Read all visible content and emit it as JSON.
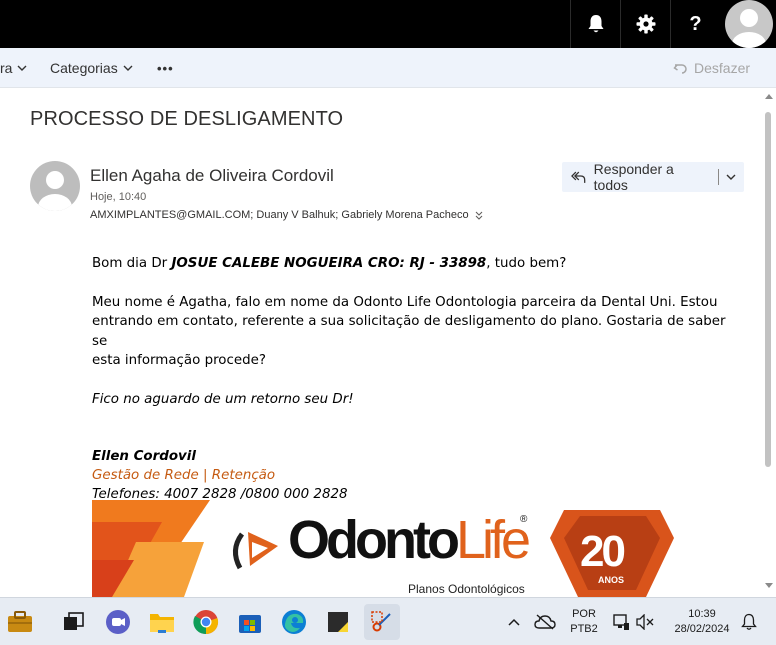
{
  "topbar": {
    "icons": [
      "bell-icon",
      "gear-icon",
      "help-icon",
      "user-avatar"
    ],
    "help_glyph": "?"
  },
  "commandbar": {
    "partial_item": "ra",
    "categories_label": "Categorias",
    "more_label": "•••",
    "undo_label": "Desfazer"
  },
  "message": {
    "subject": "PROCESSO DE DESLIGAMENTO",
    "sender_name": "Ellen Agaha de Oliveira Cordovil",
    "sent_time": "Hoje, 10:40",
    "recipients": "AMXIMPLANTES@GMAIL.COM; Duany V Balhuk; Gabriely Morena Pacheco",
    "reply_all_label": "Responder a todos",
    "body": {
      "greeting_prefix": "Bom dia Dr ",
      "greeting_name": "JOSUE CALEBE NOGUEIRA CRO: RJ - 33898",
      "greeting_suffix": ", tudo bem?",
      "para1_line1": "Meu nome é Agatha, falo em nome da Odonto Life Odontologia parceira da Dental Uni. Estou",
      "para1_line2": "entrando em contato, referente a sua solicitação de desligamento do plano. Gostaria de saber se",
      "para1_line3": "esta informação procede?",
      "para2": "Fico no aguardo de um retorno seu Dr!",
      "sig_name": "Ellen Cordovil",
      "sig_role": "Gestão de Rede | Retenção",
      "sig_phones": "Telefones: 4007 2828 /0800 000 2828"
    },
    "banner": {
      "brand_part1": "Odonto",
      "brand_part2": "Life",
      "registered": "®",
      "tagline": "Planos Odontológicos",
      "badge_number": "20",
      "badge_text": "ANOS"
    }
  },
  "taskbar": {
    "apps": [
      "briefcase-app-icon",
      "task-view-icon",
      "teams-chat-icon",
      "file-explorer-icon",
      "chrome-icon",
      "store-icon",
      "edge-icon",
      "sticky-notes-icon",
      "snipping-tool-icon"
    ],
    "lang_line1": "POR",
    "lang_line2": "PTB2",
    "time": "10:39",
    "date": "28/02/2024"
  },
  "colors": {
    "accent_orange": "#c55a11",
    "logo_orange": "#e0621c",
    "commandbar_bg": "#eef3fb"
  }
}
